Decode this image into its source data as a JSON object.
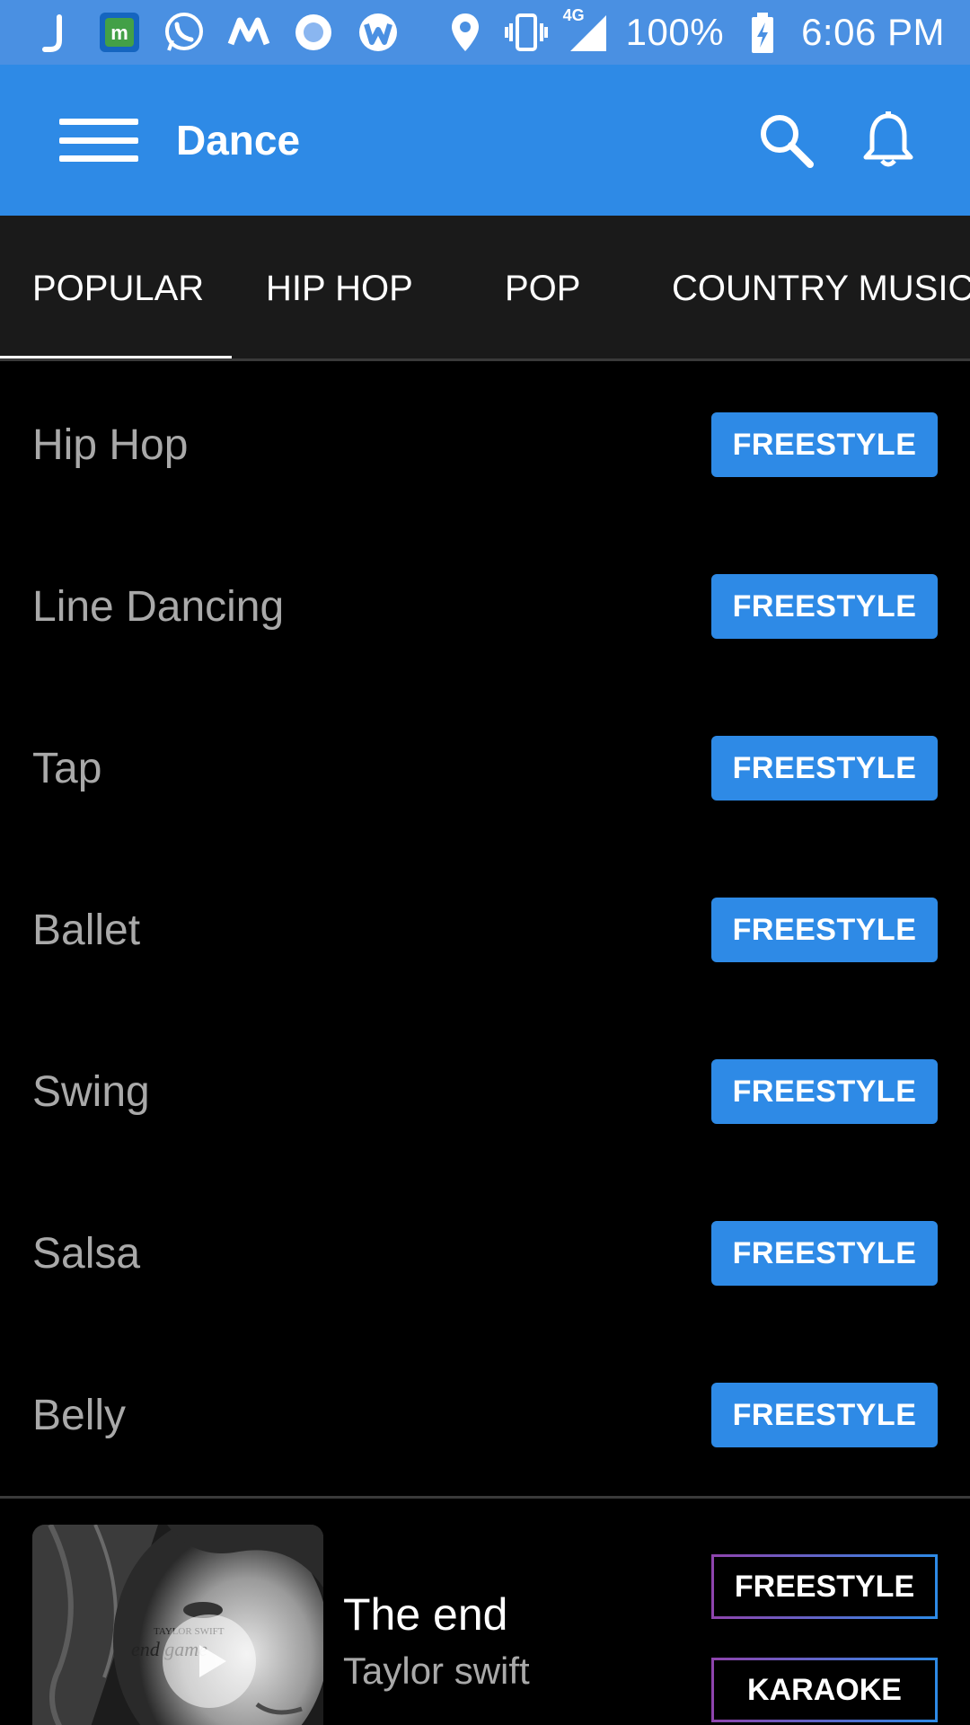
{
  "status_bar": {
    "network": "4G",
    "battery": "100%",
    "time": "6:06 PM",
    "notification_icons": [
      "j-icon",
      "m-app-icon",
      "whatsapp-icon",
      "m-logo-icon",
      "circle-app-icon",
      "w-app-icon"
    ],
    "system_icons": [
      "location-icon",
      "vibrate-icon",
      "signal-icon",
      "battery-charging-icon"
    ]
  },
  "app_bar": {
    "title": "Dance",
    "actions": [
      "search-icon",
      "bell-icon"
    ]
  },
  "tabs": {
    "items": [
      "POPULAR",
      "HIP HOP",
      "POP",
      "COUNTRY MUSIC"
    ],
    "selected": "POPULAR"
  },
  "list": {
    "items": [
      {
        "label": "Hip Hop",
        "button": "FREESTYLE"
      },
      {
        "label": "Line Dancing",
        "button": "FREESTYLE"
      },
      {
        "label": "Tap",
        "button": "FREESTYLE"
      },
      {
        "label": "Ballet",
        "button": "FREESTYLE"
      },
      {
        "label": "Swing",
        "button": "FREESTYLE"
      },
      {
        "label": "Salsa",
        "button": "FREESTYLE"
      },
      {
        "label": "Belly",
        "button": "FREESTYLE"
      }
    ]
  },
  "now_playing": {
    "title": "The end",
    "artist": "Taylor swift",
    "album_art_text": [
      "TAYLOR SWIFT",
      "end game"
    ],
    "freestyle_label": "FREESTYLE",
    "karaoke_label": "KARAOKE"
  },
  "colors": {
    "status_bar": "#4a90e2",
    "app_bar": "#2e8ae6",
    "tab_bar": "#1a1a1a",
    "background": "#000000",
    "accent_button": "#2e8ae6",
    "list_text": "#a9a9a9"
  }
}
